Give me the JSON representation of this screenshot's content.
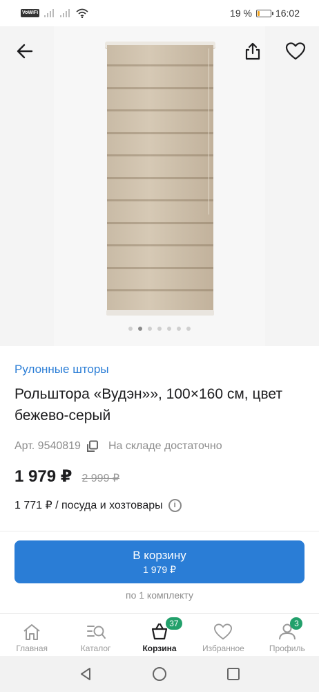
{
  "status_bar": {
    "network_badge": "VoWiFi",
    "battery": "19 %",
    "battery_level": 0.19,
    "time": "16:02"
  },
  "gallery": {
    "slides_count": 7,
    "active_slide": 2
  },
  "product": {
    "category": "Рулонные шторы",
    "title": "Рольштора «Вудэн»», 100×160 см, цвет бежево-серый",
    "article": "Арт. 9540819",
    "stock": "На складе достаточно",
    "price": "1 979 ₽",
    "old_price": "2 999 ₽",
    "promo": "1 771 ₽ / посуда и хозтовары"
  },
  "cart_button": {
    "label": "В корзину",
    "price": "1 979 ₽"
  },
  "per_set": "по 1 комплекту",
  "nav": {
    "items": [
      {
        "label": "Главная",
        "icon": "home-icon"
      },
      {
        "label": "Каталог",
        "icon": "catalog-search-icon"
      },
      {
        "label": "Корзина",
        "icon": "cart-icon",
        "badge": "37"
      },
      {
        "label": "Избранное",
        "icon": "heart-icon"
      },
      {
        "label": "Профиль",
        "icon": "profile-icon",
        "badge": "3"
      }
    ]
  },
  "colors": {
    "accent": "#2a7dd6",
    "badge": "#22a06b"
  }
}
